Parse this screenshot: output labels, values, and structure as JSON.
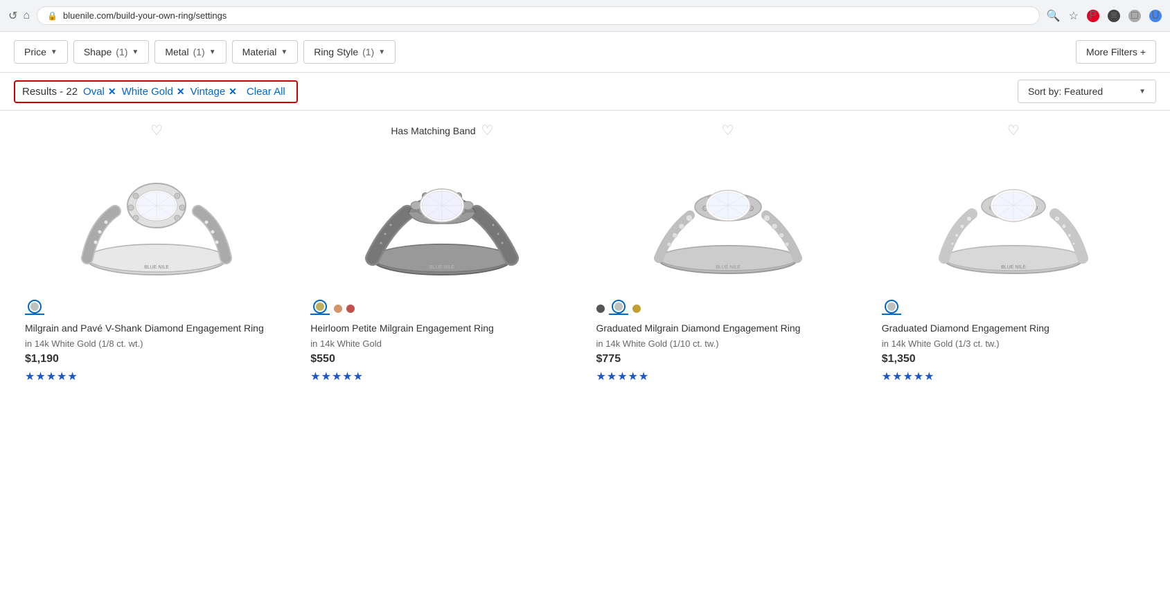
{
  "browser": {
    "url": "bluenile.com/build-your-own-ring/settings",
    "nav_icons": [
      "↺",
      "⌂"
    ]
  },
  "filters": {
    "price_label": "Price",
    "shape_label": "Shape",
    "shape_count": "(1)",
    "metal_label": "Metal",
    "metal_count": "(1)",
    "material_label": "Material",
    "ring_style_label": "Ring Style",
    "ring_style_count": "(1)",
    "more_filters_label": "More Filters +"
  },
  "results_bar": {
    "results_label": "Results - 22",
    "filter_oval": "Oval",
    "filter_white_gold": "White Gold",
    "filter_vintage": "Vintage",
    "clear_all": "Clear All",
    "sort_label": "Sort by: Featured"
  },
  "product_area": {
    "has_matching_band": "Has Matching Band"
  },
  "products": [
    {
      "name": "Milgrain and Pavé V-Shank Diamond Engagement Ring",
      "material": "in 14k White Gold (1/8 ct. wt.)",
      "price": "$1,190",
      "stars": "★★★★★",
      "swatches": [
        {
          "color": "#c0c0c0",
          "selected": true
        }
      ],
      "ring_type": "vintage_pave"
    },
    {
      "name": "Heirloom Petite Milgrain Engagement Ring",
      "material": "in 14k White Gold",
      "price": "$550",
      "stars": "★★★★★",
      "swatches": [
        {
          "color": "#c0b060",
          "selected": true
        },
        {
          "color": "#d4956a",
          "selected": false
        },
        {
          "color": "#c0504a",
          "selected": false
        }
      ],
      "ring_type": "heirloom_milgrain"
    },
    {
      "name": "Graduated Milgrain Diamond Engagement Ring",
      "material": "in 14k White Gold (1/10 ct. tw.)",
      "price": "$775",
      "stars": "★★★★★",
      "swatches": [
        {
          "color": "#555555",
          "selected": false
        },
        {
          "color": "#c0c0c0",
          "selected": true
        },
        {
          "color": "#c0a030",
          "selected": false
        }
      ],
      "ring_type": "graduated_milgrain"
    },
    {
      "name": "Graduated Diamond Engagement Ring",
      "material": "in 14k White Gold (1/3 ct. tw.)",
      "price": "$1,350",
      "stars": "★★★★★",
      "swatches": [
        {
          "color": "#c0c0c0",
          "selected": true
        }
      ],
      "ring_type": "graduated_pave"
    }
  ]
}
